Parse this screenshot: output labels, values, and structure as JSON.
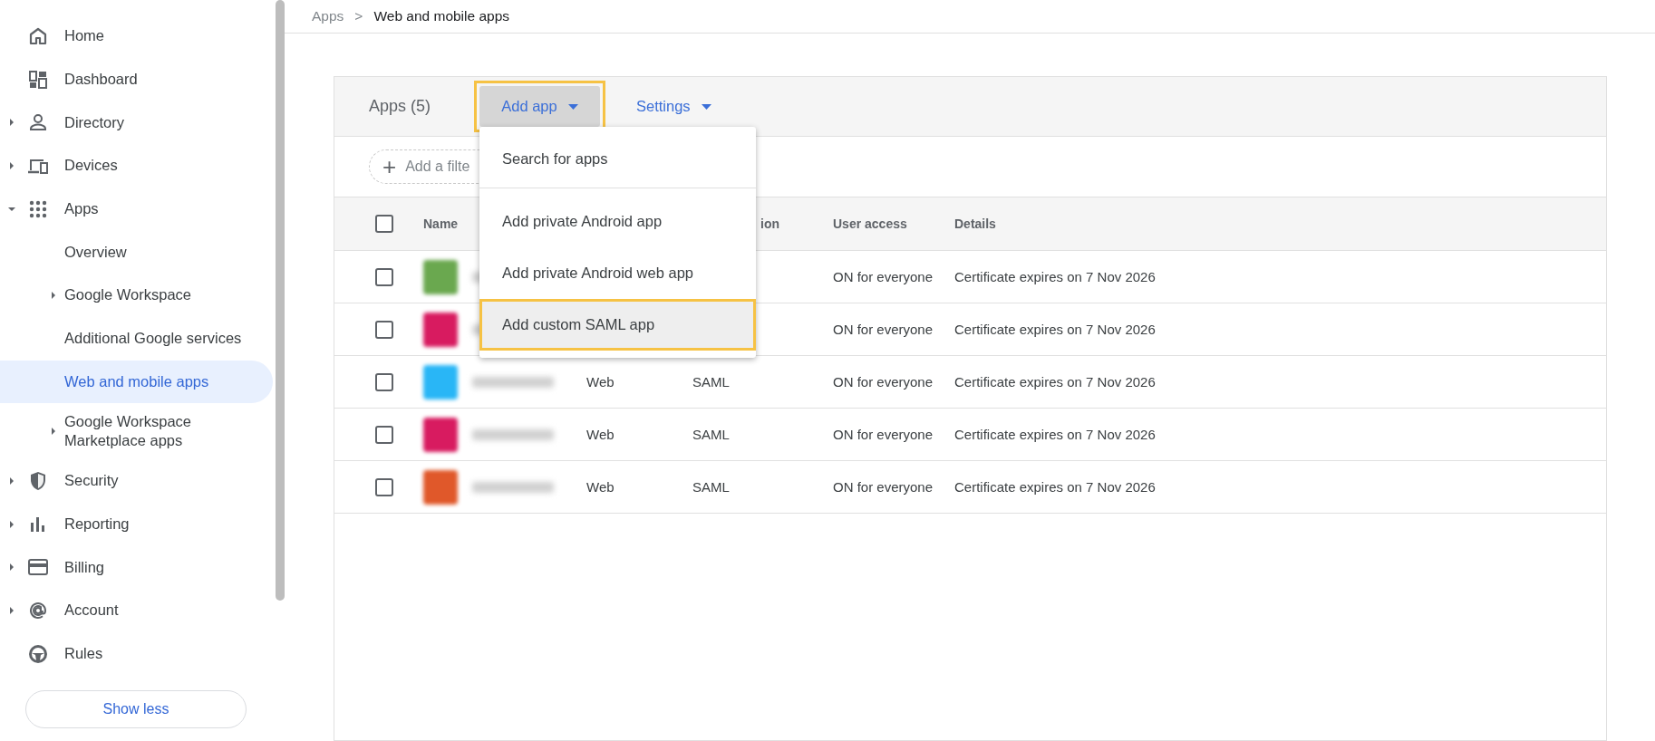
{
  "sidebar": {
    "items": [
      {
        "label": "Home",
        "selected": false
      },
      {
        "label": "Dashboard",
        "selected": false
      },
      {
        "label": "Directory",
        "selected": false,
        "expanded": false
      },
      {
        "label": "Devices",
        "selected": false,
        "expanded": false
      },
      {
        "label": "Apps",
        "selected": false,
        "expanded": true,
        "children": [
          {
            "label": "Overview",
            "selected": false
          },
          {
            "label": "Google Workspace",
            "selected": false,
            "expanded": false
          },
          {
            "label": "Additional Google services",
            "selected": false
          },
          {
            "label": "Web and mobile apps",
            "selected": true
          },
          {
            "label": "Google Workspace\nMarketplace apps",
            "selected": false,
            "expanded": false
          }
        ]
      },
      {
        "label": "Security",
        "selected": false,
        "expanded": false
      },
      {
        "label": "Reporting",
        "selected": false,
        "expanded": false
      },
      {
        "label": "Billing",
        "selected": false,
        "expanded": false
      },
      {
        "label": "Account",
        "selected": false,
        "expanded": false
      },
      {
        "label": "Rules",
        "selected": false
      }
    ],
    "show_less": "Show less"
  },
  "breadcrumb": {
    "parent": "Apps",
    "separator": ">",
    "current": "Web and mobile apps"
  },
  "card": {
    "title": "Apps (5)",
    "add_app": {
      "label": "Add app",
      "highlighted": true
    },
    "settings": "Settings",
    "filter": {
      "icon": "+",
      "label": "Add a filte"
    },
    "menu": {
      "items": [
        {
          "label": "Search for apps",
          "highlighted": false
        },
        {
          "label": "Add private Android app",
          "highlighted": false
        },
        {
          "label": "Add private Android web app",
          "highlighted": false
        },
        {
          "label": "Add custom SAML app",
          "highlighted": true
        }
      ]
    },
    "table": {
      "select_all_checked": false,
      "columns": [
        "Name",
        "ion",
        "User access",
        "Details"
      ],
      "rows": [
        {
          "color": "#6aa84f",
          "access": "ON for everyone",
          "details": "Certificate expires on 7 Nov 2026",
          "checked": false
        },
        {
          "color": "#d81b60",
          "access": "ON for everyone",
          "details": "Certificate expires on 7 Nov 2026",
          "checked": false
        },
        {
          "color": "#29b6f6",
          "type": "Web",
          "auth": "SAML",
          "access": "ON for everyone",
          "details": "Certificate expires on 7 Nov 2026",
          "checked": false
        },
        {
          "color": "#d81b60",
          "type": "Web",
          "auth": "SAML",
          "access": "ON for everyone",
          "details": "Certificate expires on 7 Nov 2026",
          "checked": false
        },
        {
          "color": "#e0582a",
          "type": "Web",
          "auth": "SAML",
          "access": "ON for everyone",
          "details": "Certificate expires on 7 Nov 2026",
          "checked": false
        }
      ]
    }
  }
}
